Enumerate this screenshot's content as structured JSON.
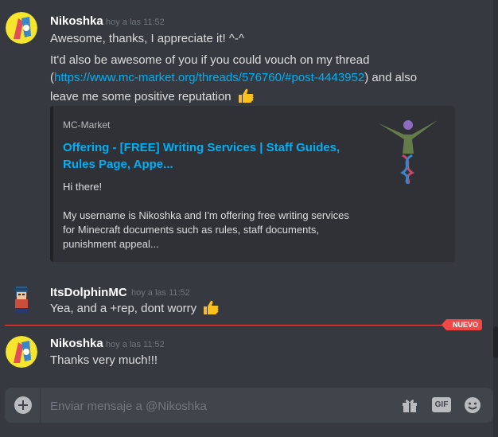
{
  "messages": [
    {
      "author": "Nikoshka",
      "timestamp": "hoy a las 11:52",
      "lines": [
        "Awesome, thanks, I appreciate it! ^-^"
      ],
      "line2_pre": "It'd also be awesome of you if you could vouch on my thread",
      "line3_open": "(",
      "line3_link": "https://www.mc-market.org/threads/576760/#post-4443952",
      "line3_post": ") and also",
      "line4": "leave me some positive reputation"
    },
    {
      "author": "ItsDolphinMC",
      "timestamp": "hoy a las 11:52",
      "text": "Yea, and a +rep, dont worry"
    },
    {
      "author": "Nikoshka",
      "timestamp": "hoy a las 11:52",
      "text": "Thanks very much!!!"
    }
  ],
  "embed": {
    "provider": "MC-Market",
    "title": "Offering - [FREE] Writing Services | Staff Guides, Rules Page, Appe...",
    "description": "Hi there!\n\nMy username is Nikoshka and I'm offering free writing services\nfor Minecraft documents such as rules, staff documents,\npunishment appeal...",
    "thumbnail_icon": "dna-figure-thumbnail"
  },
  "new_divider_label": "NUEVO",
  "input": {
    "placeholder": "Enviar mensaje a @Nikoshka",
    "gif_label": "GIF"
  },
  "colors": {
    "background": "#36393f",
    "link": "#00b0f4",
    "new_marker": "#f04747"
  }
}
